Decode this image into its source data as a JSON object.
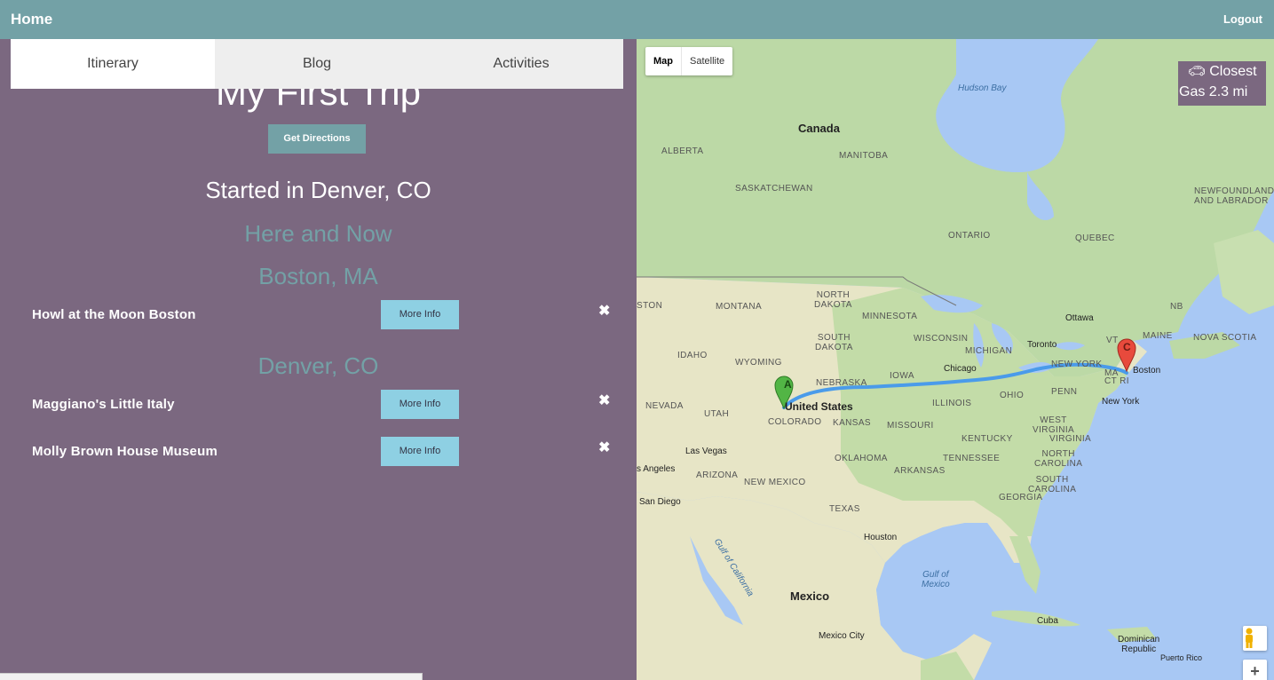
{
  "nav": {
    "home": "Home",
    "logout": "Logout"
  },
  "tabs": [
    {
      "label": "Itinerary",
      "active": true
    },
    {
      "label": "Blog",
      "active": false
    },
    {
      "label": "Activities",
      "active": false
    }
  ],
  "trip": {
    "title": "My First Trip",
    "directions_label": "Get Directions",
    "start": "Started in Denver, CO",
    "now_heading": "Here and Now",
    "groups": [
      {
        "city": "Boston, MA",
        "items": [
          {
            "name": "Howl at the Moon Boston",
            "button": "More Info",
            "remove": "✖"
          }
        ]
      },
      {
        "city": "Denver, CO",
        "items": [
          {
            "name": "Maggiano's Little Italy",
            "button": "More Info",
            "remove": "✖"
          },
          {
            "name": "Molly Brown House Museum",
            "button": "More Info",
            "remove": "✖"
          }
        ]
      }
    ]
  },
  "map": {
    "types": {
      "map": "Map",
      "satellite": "Satellite",
      "selected": "Map"
    },
    "gas": {
      "icon": "car-icon",
      "line1": "Closest",
      "line2": "Gas 2.3 mi"
    },
    "markers": {
      "start": "A",
      "end": "C"
    },
    "zoom_in": "+",
    "labels": {
      "hudson_bay": "Hudson Bay",
      "canada": "Canada",
      "alberta": "ALBERTA",
      "manitoba": "MANITOBA",
      "saskatchewan": "SASKATCHEWAN",
      "ontario": "ONTARIO",
      "quebec": "QUEBEC",
      "newfoundland": "NEWFOUNDLAND\nAND LABRADOR",
      "montana": "MONTANA",
      "north_dakota": "NORTH\nDAKOTA",
      "minnesota": "MINNESOTA",
      "south_dakota": "SOUTH\nDAKOTA",
      "wisconsin": "WISCONSIN",
      "idaho": "IDAHO",
      "wyoming": "WYOMING",
      "michigan": "MICHIGAN",
      "iowa": "IOWA",
      "nebraska": "NEBRASKA",
      "nevada": "NEVADA",
      "utah": "UTAH",
      "colorado": "COLORADO",
      "united_states": "United States",
      "illinois": "ILLINOIS",
      "ohio": "OHIO",
      "penn": "PENN",
      "new_york_state": "NEW YORK",
      "kansas": "KANSAS",
      "missouri": "MISSOURI",
      "kentucky": "KENTUCKY",
      "west_virginia": "WEST\nVIRGINIA",
      "virginia": "VIRGINIA",
      "oklahoma": "OKLAHOMA",
      "arkansas": "ARKANSAS",
      "tennessee": "TENNESSEE",
      "north_carolina": "NORTH\nCAROLINA",
      "arizona": "ARIZONA",
      "new_mexico": "NEW MEXICO",
      "south_carolina": "SOUTH\nCAROLINA",
      "georgia": "GEORGIA",
      "texas": "TEXAS",
      "nova_scotia": "NOVA SCOTIA",
      "maine": "MAINE",
      "nb": "NB",
      "vt": "VT",
      "ma": "MA",
      "ct_ri": "CT RI",
      "mexico": "Mexico",
      "gulf_mexico": "Gulf of\nMexico",
      "gulf_california": "Gulf of California",
      "cuba": "Cuba",
      "dominican": "Dominican\nRepublic",
      "puerto_rico": "Puerto Rico",
      "ston": "STON",
      "angeles": "s Angeles",
      "las_vegas": "Las Vegas",
      "san_diego": "San Diego",
      "chicago": "Chicago",
      "toronto": "Toronto",
      "ottawa": "Ottawa",
      "boston": "Boston",
      "new_york": "New York",
      "houston": "Houston",
      "mexico_city": "Mexico City"
    }
  }
}
